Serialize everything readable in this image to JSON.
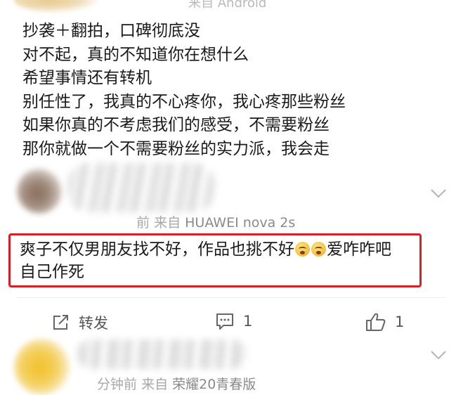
{
  "top_meta": "来自 Android",
  "post": {
    "lines": [
      "抄袭＋翻拍，口碑彻底没",
      "对不起，真的不知道你在想什么",
      "希望事情还有转机",
      "别任性了，我真的不心疼你，我心疼那些粉丝",
      "如果你真的不考虑我们的感受，不需要粉丝",
      "那你就做一个不需要粉丝的实力派，我会走"
    ]
  },
  "comment1": {
    "time": "前",
    "source_prefix": "来自",
    "device": "HUAWEI nova 2s",
    "text_line1_a": "爽子不仅男朋友找不好，作品也挑不好",
    "emoji_name": "fearful-face-emoji",
    "text_line1_b": "爱咋咋吧",
    "text_line2": "自己作死",
    "highlight_color": "#d91f26"
  },
  "actions": {
    "forward_label": "转发",
    "comment_count": "1",
    "like_count": "1"
  },
  "comment2": {
    "time": "分钟前",
    "source_prefix": "来自",
    "device": "荣耀20青春版"
  }
}
